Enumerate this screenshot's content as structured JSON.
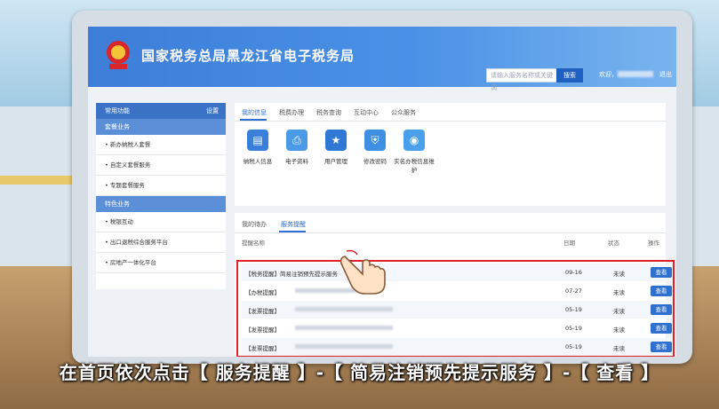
{
  "header": {
    "title": "国家税务总局黑龙江省电子税务局",
    "search_placeholder": "请输入服务名称或关键词",
    "search_button": "搜索",
    "welcome": "欢迎，",
    "logout": "退出"
  },
  "sidebar": {
    "head_label": "常用功能",
    "head_right": "设置",
    "sections": [
      {
        "label": "套餐业务",
        "items": [
          "新办纳税人套餐",
          "自定义套餐服务",
          "专题套餐服务"
        ]
      },
      {
        "label": "特色业务",
        "items": [
          "税银互动",
          "出口退税综合服务平台",
          "房地产一体化平台"
        ]
      }
    ]
  },
  "top_panel": {
    "tabs": [
      "我的信息",
      "税费办理",
      "税务查询",
      "互动中心",
      "公众服务"
    ],
    "active_tab": 0,
    "functions": [
      "纳税人信息",
      "电子资料",
      "用户管理",
      "修改密码",
      "实名办税信息维护"
    ]
  },
  "notice_panel": {
    "tabs": [
      "我的待办",
      "服务提醒"
    ],
    "active_tab": 1,
    "columns": [
      "提醒名称",
      "日期",
      "状态",
      "操作"
    ],
    "rows": [
      {
        "name": "【税务提醒】简易注销预先提示服务",
        "date": "09-16",
        "status": "未读",
        "action": "查看"
      },
      {
        "name": "【办税提醒】",
        "date": "07-27",
        "status": "未读",
        "action": "查看"
      },
      {
        "name": "【发票提醒】",
        "date": "05-19",
        "status": "未读",
        "action": "查看"
      },
      {
        "name": "【发票提醒】",
        "date": "05-19",
        "status": "未读",
        "action": "查看"
      },
      {
        "name": "【发票提醒】",
        "date": "05-19",
        "status": "未读",
        "action": "查看"
      }
    ]
  },
  "caption": "在首页依次点击【 服务提醒 】-【 简易注销预先提示服务 】-【 查看 】",
  "colors": {
    "header_blue": "#3d7dd8",
    "highlight_red": "#e0202a",
    "button_blue": "#2f6fd0"
  }
}
